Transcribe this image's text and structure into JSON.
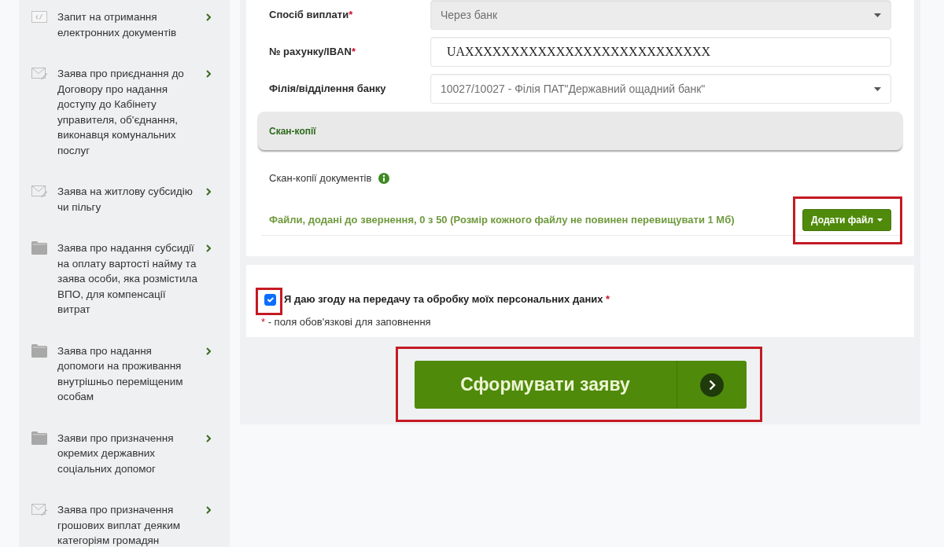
{
  "sidebar": {
    "items": [
      {
        "kind": "certificate",
        "label": "Запит на отримання електронних документів"
      },
      {
        "kind": "envelope",
        "label": "Заява про приєднання до Договору про надання доступу до Кабінету управителя, об'єднання, виконавця комунальних послуг"
      },
      {
        "kind": "envelope",
        "label": "Заява на житлову субсидію чи пільгу"
      },
      {
        "kind": "folder",
        "label": "Заява про надання субсидії на оплату вартості найму та заява особи, яка розмістила ВПО, для компенсації витрат"
      },
      {
        "kind": "folder",
        "label": "Заява про надання допомоги на проживання внутрішньо переміщеним особам"
      },
      {
        "kind": "folder",
        "label": "Заяви про призначення окремих державних соціальних допомог"
      },
      {
        "kind": "envelope",
        "label": "Заява про призначення грошових виплат деяким категоріям громадян"
      }
    ]
  },
  "form": {
    "fields": [
      {
        "kind": "select",
        "label": "Спосіб виплати",
        "mark": "*",
        "value": "Через банк",
        "disabled": true
      },
      {
        "kind": "input",
        "label": "№ рахунку/IBAN",
        "mark": "*",
        "value": "UAXXXXXXXXXXXXXXXXXXXXXXXXXXX",
        "disabled": false
      },
      {
        "kind": "select",
        "label": "Філія/відділення банку",
        "value": "10027/10027 - Філія ПАТ\"Державний ощадний банк\"",
        "disabled": false
      }
    ],
    "section": {
      "title": "Скан-копії"
    },
    "scans": {
      "label": "Скан-копії документів",
      "files_note": "Файли, додані до звернення, 0 з 50 (Розмір кожного файлу не повинен перевищувати 1 Мб)",
      "add_button": {
        "label": "Додати файл",
        "highlighted": true
      }
    }
  },
  "consent": {
    "label": "Я даю згоду на передачу та обробку моїх персональних даних",
    "mark": "*",
    "checked": true,
    "highlighted": true
  },
  "footnote": {
    "mark": "*",
    "text": "- поля обов'язкові для заповнення"
  },
  "submit": {
    "label": "Сформувати заяву",
    "highlighted": true
  }
}
